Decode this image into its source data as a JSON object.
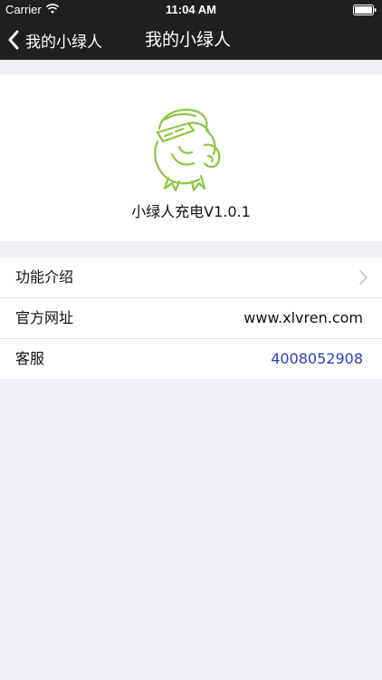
{
  "status_bar": {
    "carrier": "Carrier",
    "time": "11:04 AM"
  },
  "nav": {
    "back_label": "我的小绿人",
    "title": "我的小绿人"
  },
  "about": {
    "app_version": "小绿人充电V1.0.1",
    "logo_color": "#8dc63f"
  },
  "rows": [
    {
      "label": "功能介绍",
      "value": ""
    },
    {
      "label": "官方网址",
      "value": "www.xlvren.com"
    },
    {
      "label": "客服",
      "value": "4008052908"
    }
  ],
  "colors": {
    "nav_bg": "#1f1f1f",
    "page_bg": "#efeff4",
    "link": "#2a3fc3"
  }
}
